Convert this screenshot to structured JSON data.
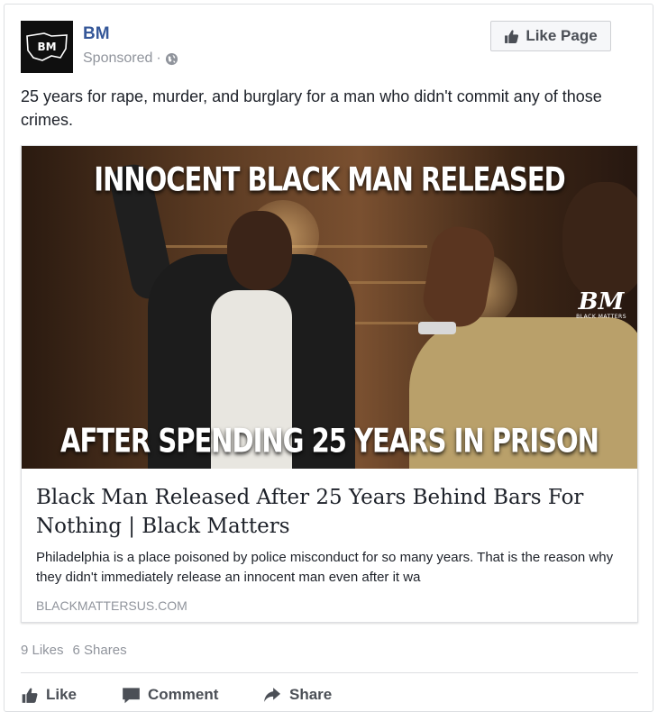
{
  "post": {
    "page_name": "BM",
    "sponsored_label": "Sponsored",
    "meta_separator": "·",
    "like_page_label": "Like Page",
    "avatar_text": "BM",
    "text": "25 years for rape, murder, and burglary for a man who didn't commit any of those crimes."
  },
  "attachment": {
    "image_headline_top": "INNOCENT BLACK MAN RELEASED",
    "image_headline_bottom": "AFTER SPENDING 25 YEARS IN PRISON",
    "watermark_mark": "BM",
    "watermark_sub": "BLACK MATTERS",
    "title": "Black Man Released After 25 Years Behind Bars For Nothing | Black Matters",
    "description": "Philadelphia is a place poisoned by police misconduct for so many years. That is the reason why they didn't immediately release an innocent man even after it wa",
    "domain": "BLACKMATTERSUS.COM"
  },
  "counts": {
    "likes": "9 Likes",
    "shares": "6 Shares"
  },
  "actions": {
    "like": "Like",
    "comment": "Comment",
    "share": "Share"
  },
  "colors": {
    "link_blue": "#365899",
    "meta_gray": "#90949c",
    "action_gray": "#4b4f56"
  },
  "icons": {
    "globe": "globe-icon",
    "like_page": "thumbs-up-icon",
    "like": "thumbs-up-icon",
    "comment": "comment-icon",
    "share": "share-arrow-icon"
  }
}
